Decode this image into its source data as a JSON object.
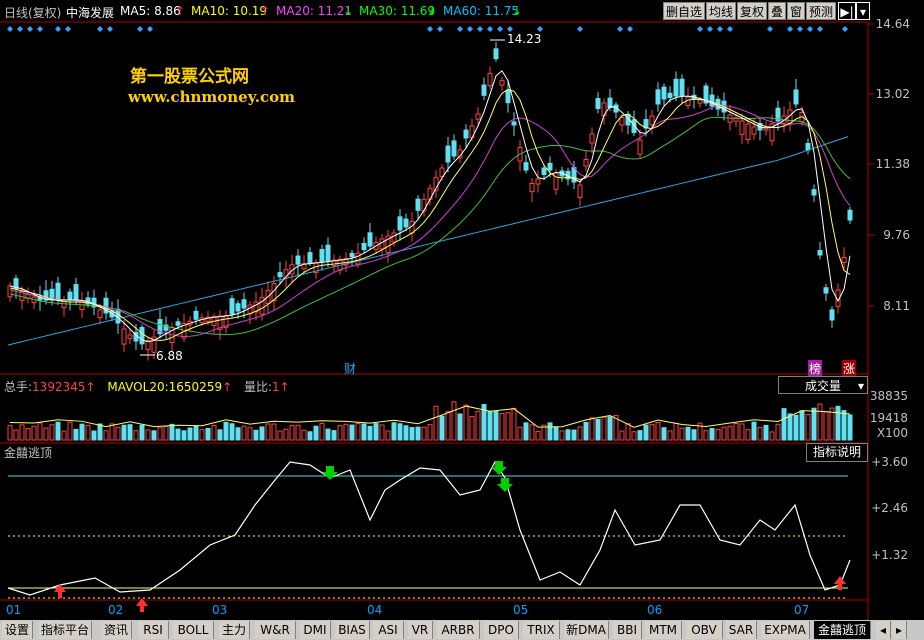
{
  "header": {
    "period": "日线(复权)",
    "stock_name": "中海发展",
    "ma5_label": "MA5:",
    "ma5_value": "8.86",
    "ma10_label": "MA10:",
    "ma10_value": "10.19",
    "ma20_label": "MA20:",
    "ma20_value": "11.21",
    "ma30_label": "MA30:",
    "ma30_value": "11.69",
    "ma60_label": "MA60:",
    "ma60_value": "11.75",
    "buttons": [
      "删自选",
      "均线",
      "复权",
      "叠",
      "窗",
      "预测"
    ],
    "colors": {
      "ma5": "#ffffff",
      "ma10": "#ffff00",
      "ma20": "#ff40ff",
      "ma30": "#00ff00",
      "ma60": "#00c0ff"
    }
  },
  "watermark": {
    "name": "第一股票公式网",
    "url": "www.chnmoney.com"
  },
  "price_axis": [
    "14.64",
    "13.02",
    "11.38",
    "9.76",
    "8.11"
  ],
  "annotations": {
    "high": "14.23",
    "low": "6.88",
    "cai": "财",
    "bang": "榜",
    "zhang": "涨"
  },
  "volume": {
    "total_label": "总手:",
    "total_value": "1392345",
    "mavol_label": "MAVOL20:",
    "mavol_value": "1650259",
    "ratio_label": "量比:",
    "ratio_value": "1",
    "indicator": "成交量",
    "axis": [
      "38835",
      "19418",
      "X100"
    ]
  },
  "indicator": {
    "name": "金囍逃顶",
    "help_button": "指标说明",
    "axis": [
      "+3.60",
      "+2.46",
      "+1.32"
    ]
  },
  "dates": [
    "01",
    "02",
    "03",
    "04",
    "05",
    "06",
    "07"
  ],
  "tabs": [
    "设置",
    "指标平台",
    "资讯",
    "RSI",
    "BOLL",
    "主力",
    "W&R",
    "DMI",
    "BIAS",
    "ASI",
    "VR",
    "ARBR",
    "DPO",
    "TRIX",
    "新DMA",
    "BBI",
    "MTM",
    "OBV",
    "SAR",
    "EXPMA",
    "金囍逃顶"
  ],
  "active_tab": "金囍逃顶"
}
